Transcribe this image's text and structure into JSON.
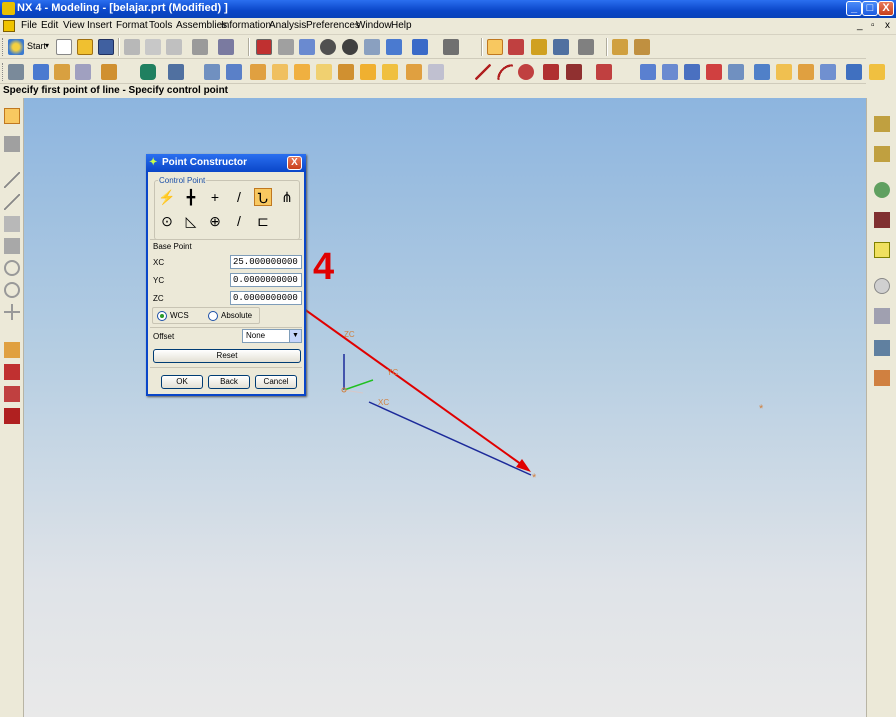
{
  "window": {
    "title": "NX 4 - Modeling - [belajar.prt (Modified) ]",
    "min": "_",
    "max": "□",
    "close": "X"
  },
  "menu": {
    "items": [
      "File",
      "Edit",
      "View",
      "Insert",
      "Format",
      "Tools",
      "Assemblies",
      "Information",
      "Analysis",
      "Preferences",
      "Window",
      "Help"
    ],
    "doc_controls": [
      "_",
      "▫",
      "x"
    ]
  },
  "toolbar": {
    "start_label": "Start",
    "start_arrow": "▾"
  },
  "status": {
    "prompt": "Specify first point of line - Specify control point"
  },
  "dialog": {
    "title": "Point Constructor",
    "close": "X",
    "control_point_group": "Control Point",
    "control_point_icons": [
      "⚡",
      "╋",
      "+",
      "/",
      "Ն",
      "⋔",
      "⊙",
      "◺",
      "⊕",
      "/",
      "⊏"
    ],
    "base_point_label": "Base Point",
    "xc_label": "XC",
    "xc_value": "25.000000000",
    "yc_label": "YC",
    "yc_value": "0.0000000000",
    "zc_label": "ZC",
    "zc_value": "0.0000000000",
    "wcs_label": "WCS",
    "absolute_label": "Absolute",
    "coord_system": "WCS",
    "offset_label": "Offset",
    "offset_value": "None",
    "reset_label": "Reset",
    "ok_label": "OK",
    "back_label": "Back",
    "cancel_label": "Cancel"
  },
  "canvas": {
    "annotation": "4",
    "axis_zc": "ZC",
    "axis_yc": "YC",
    "axis_xc": "XC"
  },
  "colors": {
    "titlebar": "#0a46c8",
    "annotation": "#e00000",
    "axis_label": "#d08040",
    "xc_axis": "#1c2a9a",
    "yc_axis": "#20c020"
  }
}
